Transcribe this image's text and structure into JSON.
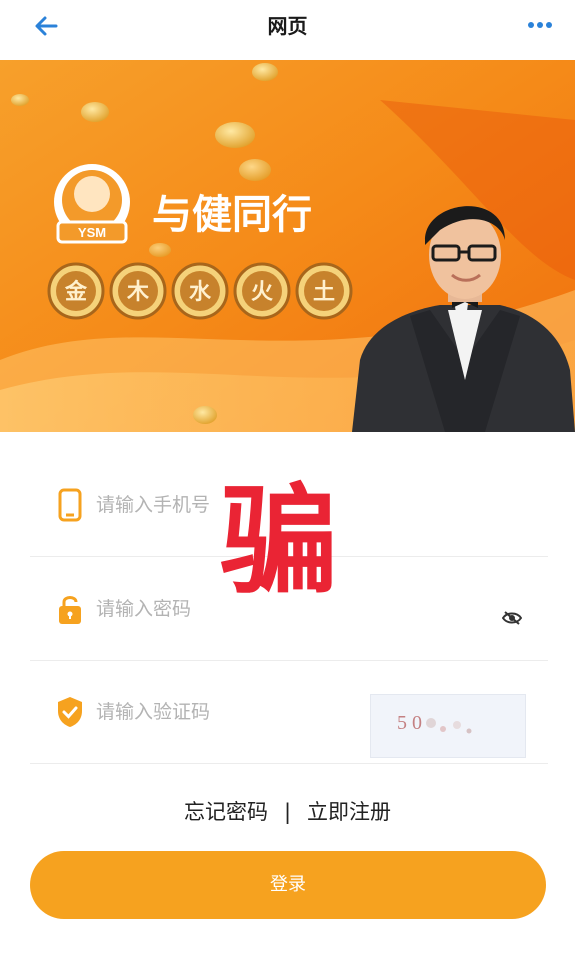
{
  "header": {
    "title": "网页",
    "back_icon": "back-arrow-icon",
    "more_icon": "more-icon"
  },
  "banner": {
    "logo_text": "YSM",
    "slogan": "与健同行",
    "coins": [
      "金",
      "木",
      "水",
      "火",
      "土"
    ]
  },
  "form": {
    "phone_placeholder": "请输入手机号",
    "password_placeholder": "请输入密码",
    "captcha_placeholder": "请输入验证码",
    "captcha_text": "5 0"
  },
  "links": {
    "forgot": "忘记密码",
    "divider": "|",
    "register": "立即注册"
  },
  "login_button": "登录",
  "stamp": "骗",
  "colors": {
    "accent": "#f6a21f",
    "link_icon": "#2b82d9",
    "stamp": "#ea2434"
  }
}
